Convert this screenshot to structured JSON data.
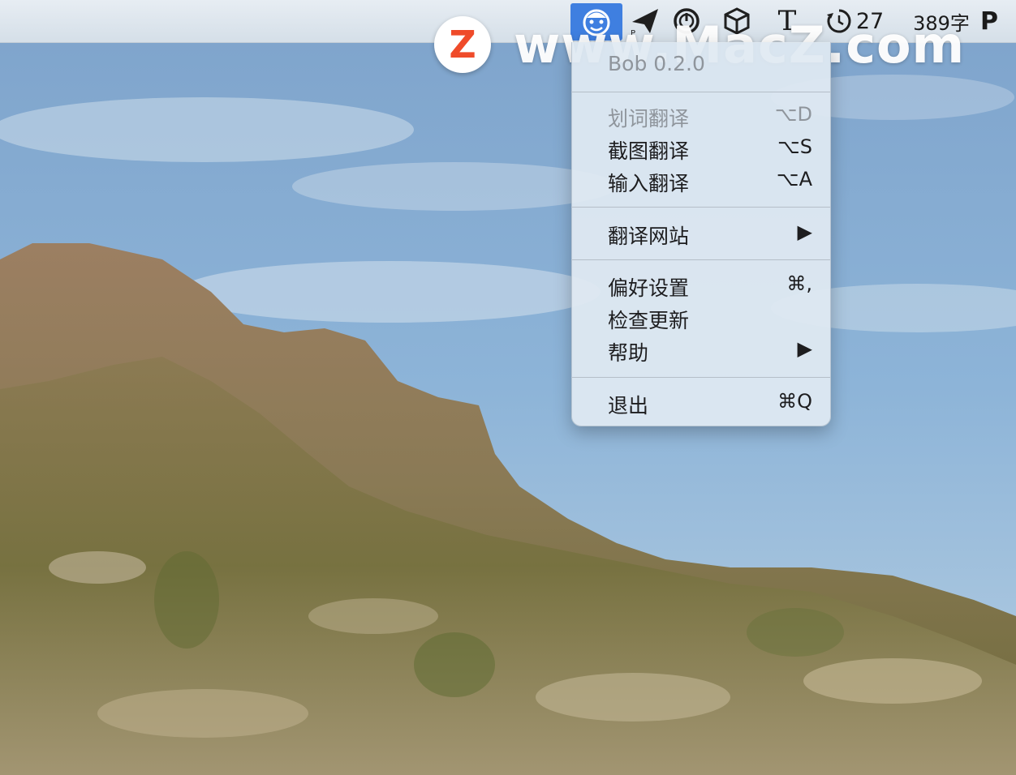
{
  "menubar": {
    "timer_value": "27",
    "word_count": "389字",
    "text_tool_label": "T",
    "pin_label": "P"
  },
  "watermark": {
    "logo_letter": "Z",
    "text": "www.MacZ.com"
  },
  "menu": {
    "version": "Bob 0.2.0",
    "items": [
      {
        "label": "划词翻译",
        "shortcut": "⌥D",
        "enabled": false
      },
      {
        "label": "截图翻译",
        "shortcut": "⌥S",
        "enabled": true
      },
      {
        "label": "输入翻译",
        "shortcut": "⌥A",
        "enabled": true
      },
      {
        "label": "翻译网站",
        "shortcut": "▶",
        "enabled": true
      },
      {
        "label": "偏好设置",
        "shortcut": "⌘,",
        "enabled": true
      },
      {
        "label": "检查更新",
        "shortcut": "",
        "enabled": true
      },
      {
        "label": "帮助",
        "shortcut": "▶",
        "enabled": true
      },
      {
        "label": "退出",
        "shortcut": "⌘Q",
        "enabled": true
      }
    ]
  },
  "colors": {
    "menu_highlight": "#3f7fe0",
    "watermark_logo": "#ef4b2a"
  },
  "icons": [
    "bob-icon",
    "send-icon",
    "clock-icon",
    "box-icon",
    "text-icon",
    "timer-icon",
    "pin-icon"
  ]
}
